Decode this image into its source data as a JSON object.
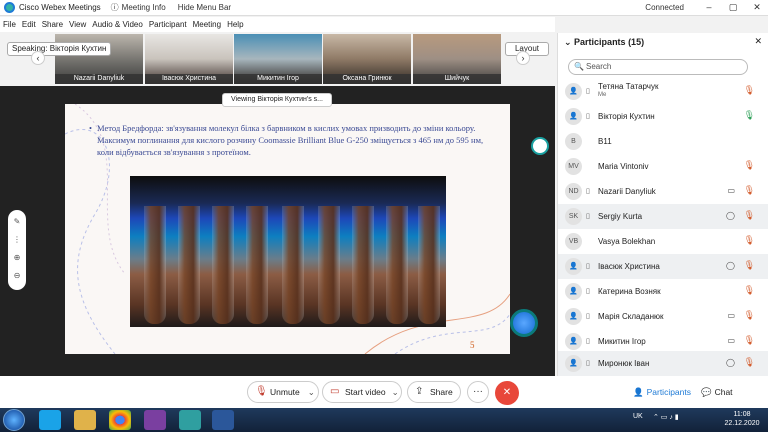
{
  "app": {
    "title": "Cisco Webex Meetings",
    "meeting_info": "Meeting Info",
    "hide_menu_bar": "Hide Menu Bar",
    "connection": "Connected",
    "window_controls": {
      "minimize": "–",
      "maximize": "▢",
      "close": "✕"
    }
  },
  "menu": [
    "File",
    "Edit",
    "Share",
    "View",
    "Audio & Video",
    "Participant",
    "Meeting",
    "Help"
  ],
  "speaking": {
    "label": "Speaking: Вікторія Кухтин"
  },
  "thumbnails": [
    {
      "name": "Nazarii Danyliuk"
    },
    {
      "name": "Івасюк Христина"
    },
    {
      "name": "Микитин Ігор"
    },
    {
      "name": "Оксана Гринюк"
    },
    {
      "name": "Шийчук"
    }
  ],
  "layout_button": "Layout",
  "viewing_banner": "Viewing Вікторія Кухтин's s...",
  "slide": {
    "text": "Метод Бредфорда: зв'язування молекул білка з барвником в кислих умовах призводить до зміни кольору.  Максимум поглинання для кислого розчину Coomassie Brilliant Blue G-250 зміщується з 465 нм до 595 нм, коли відбувається зв'язування з протеїном.",
    "page_number": "5"
  },
  "controls": {
    "unmute": "Unmute",
    "start_video": "Start video",
    "share": "Share",
    "more": "···",
    "end": "✕",
    "participants": "Participants",
    "chat": "Chat"
  },
  "panel": {
    "title": "Participants (15)",
    "close": "✕",
    "search_placeholder": "Search",
    "participants": [
      {
        "initials": "",
        "name": "Тетяна Татарчук",
        "sub": "Me",
        "mic": "muted"
      },
      {
        "initials": "",
        "name": "Вікторія Кухтин",
        "sub": "",
        "mic": "active"
      },
      {
        "initials": "B",
        "name": "B11",
        "sub": "",
        "mic": "none"
      },
      {
        "initials": "MV",
        "name": "Maria Vintoniv",
        "sub": "",
        "mic": "muted"
      },
      {
        "initials": "ND",
        "name": "Nazarii Danyliuk",
        "sub": "",
        "mic": "muted",
        "icon": "video"
      },
      {
        "initials": "SK",
        "name": "Sergiy Kurta",
        "sub": "",
        "mic": "muted",
        "icon": "chat"
      },
      {
        "initials": "VB",
        "name": "Vasya Bolekhan",
        "sub": "",
        "mic": "muted"
      },
      {
        "initials": "",
        "name": "Івасюк Христина",
        "sub": "",
        "mic": "muted",
        "icon": "chat"
      },
      {
        "initials": "",
        "name": "Катерина Возняк",
        "sub": "",
        "mic": "muted"
      },
      {
        "initials": "",
        "name": "Марія Складанюк",
        "sub": "",
        "mic": "muted",
        "icon": "video"
      },
      {
        "initials": "",
        "name": "Микитин Ігор",
        "sub": "",
        "mic": "muted",
        "icon": "video"
      },
      {
        "initials": "",
        "name": "Миронюк Іван",
        "sub": "",
        "mic": "muted",
        "icon": "chat"
      }
    ]
  },
  "taskbar": {
    "lang": "UK",
    "time": "11:08",
    "date": "22.12.2020"
  },
  "colors": {
    "accent": "#1f7bd6",
    "end_call": "#e8473a",
    "slide_text": "#3b4a94",
    "muted_mic": "#d25a2a"
  }
}
